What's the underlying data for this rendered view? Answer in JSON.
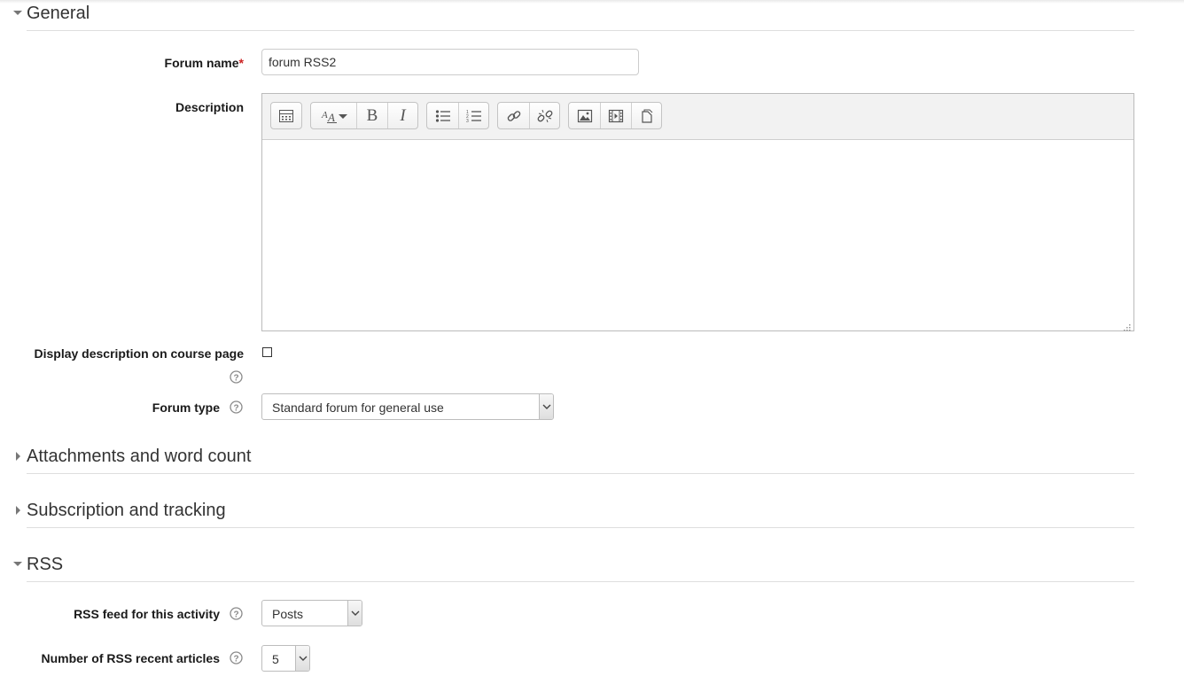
{
  "sections": {
    "general": {
      "title": "General",
      "expanded": true
    },
    "attachments": {
      "title": "Attachments and word count",
      "expanded": false
    },
    "subscription": {
      "title": "Subscription and tracking",
      "expanded": false
    },
    "rss": {
      "title": "RSS",
      "expanded": true
    }
  },
  "general": {
    "forum_name_label": "Forum name",
    "required_marker": "*",
    "forum_name_value": "forum RSS2",
    "description_label": "Description",
    "display_description_label": "Display description on course page",
    "display_description_checked": false,
    "forum_type_label": "Forum type",
    "forum_type_value": "Standard forum for general use"
  },
  "editor": {
    "toolbar_icons": [
      "toolbar-toggle-icon",
      "font-style-icon",
      "bold-icon",
      "italic-icon",
      "unordered-list-icon",
      "ordered-list-icon",
      "link-icon",
      "unlink-icon",
      "image-icon",
      "media-icon",
      "manage-files-icon"
    ],
    "bold_glyph": "B",
    "italic_glyph": "I"
  },
  "rss": {
    "feed_label": "RSS feed for this activity",
    "feed_value": "Posts",
    "articles_label": "Number of RSS recent articles",
    "articles_value": "5"
  },
  "colors": {
    "required": "#cc2222",
    "heading": "#333333",
    "divider": "#dedede"
  }
}
